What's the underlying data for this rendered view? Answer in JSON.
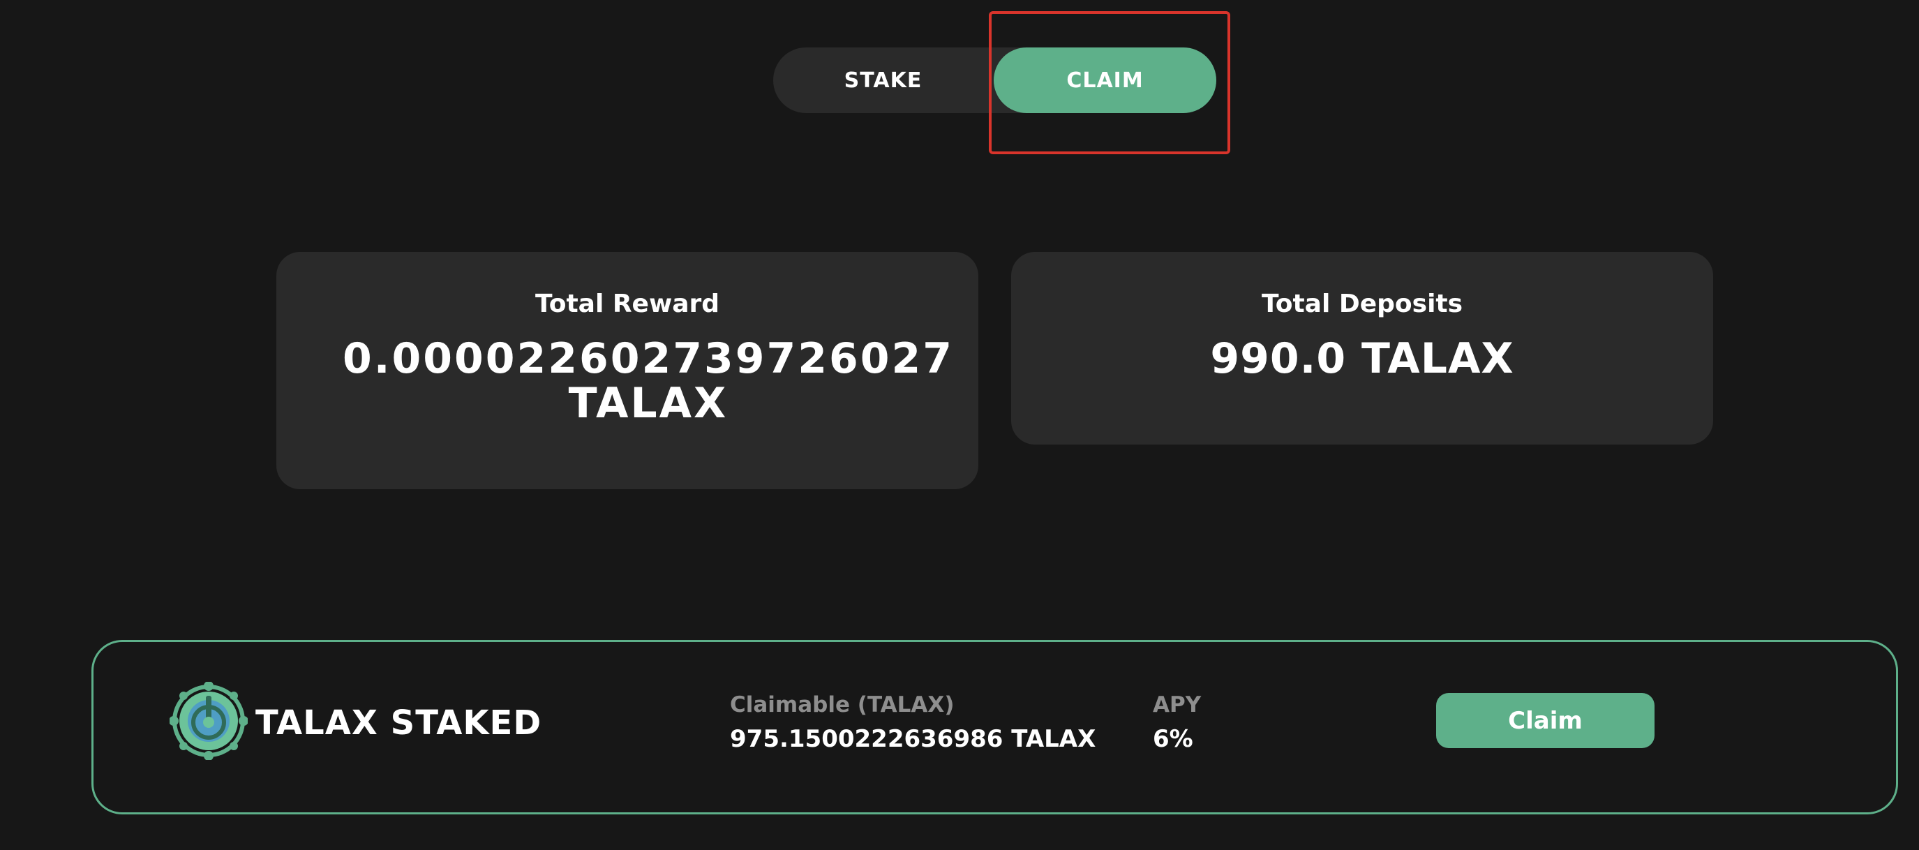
{
  "toggle": {
    "stake_label": "STAKE",
    "claim_label": "CLAIM",
    "active": "CLAIM"
  },
  "cards": {
    "total_reward": {
      "label": "Total Reward",
      "value": "0.00002260273972 6027 TALAX"
    },
    "total_deposits": {
      "label": "Total Deposits",
      "value": "990.0 TALAX"
    }
  },
  "staked_panel": {
    "logo_icon": "talax-power-logo-icon",
    "title": "TALAX STAKED",
    "claimable": {
      "label": "Claimable (TALAX)",
      "value": "975.1500222636986 TALAX"
    },
    "apy": {
      "label": "APY",
      "value": "6%"
    },
    "claim_button_label": "Claim"
  },
  "colors": {
    "background": "#171717",
    "card": "#2a2a2a",
    "accent": "#5eb08a",
    "highlight": "#d9342b",
    "muted_text": "#8e8e8e"
  }
}
